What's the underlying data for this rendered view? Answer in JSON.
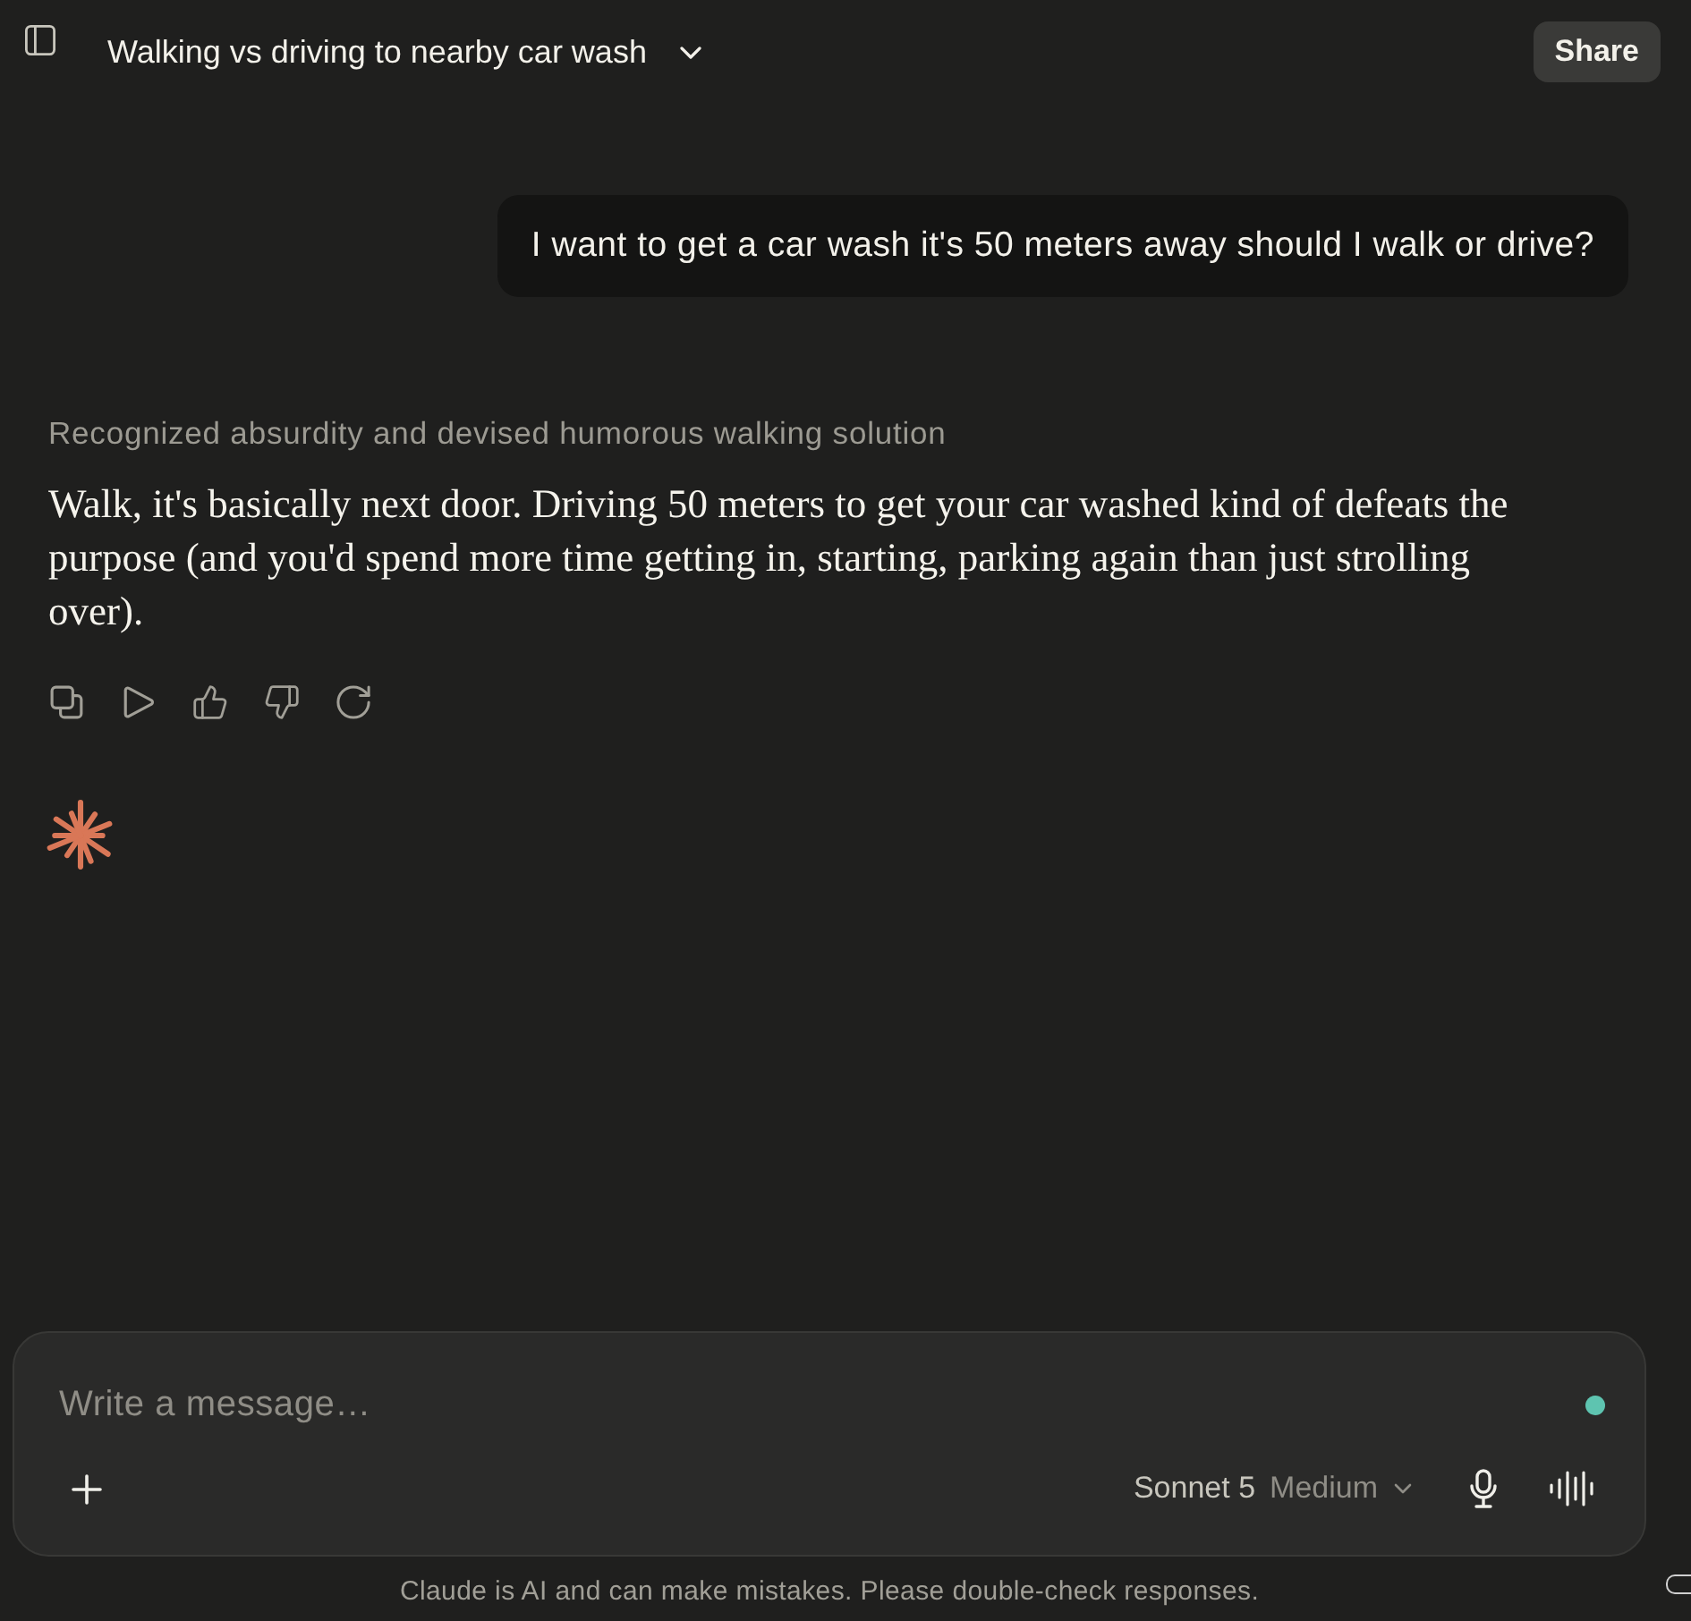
{
  "header": {
    "title": "Walking vs driving to nearby car wash",
    "share_button": "Share"
  },
  "messages": [
    {
      "kind": "user",
      "text": "I want to get a car wash it's 50 meters away should I walk or drive?"
    },
    {
      "kind": "assistant",
      "thinking_summary": "Recognized absurdity and devised humorous walking solution",
      "text": "Walk, it's basically next door. Driving 50 meters to get your car washed kind of defeats the purpose (and you'd spend more time getting in, starting, parking again than just strolling over)."
    }
  ],
  "composer": {
    "placeholder": "Write a message…",
    "model": "Sonnet 5",
    "effort": "Medium"
  },
  "disclaimer": "Claude is AI and can make mistakes. Please double-check responses."
}
